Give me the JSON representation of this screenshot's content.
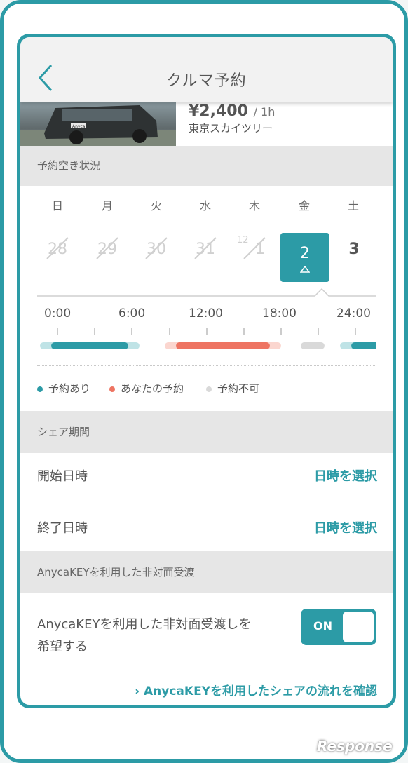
{
  "nav": {
    "title": "クルマ予約"
  },
  "car": {
    "price": "¥2,400",
    "unit": "/ 1h",
    "location": "東京スカイツリー",
    "badge": "Anyca"
  },
  "availability": {
    "section_title": "予約空き状況",
    "weekdays": [
      "日",
      "月",
      "火",
      "水",
      "木",
      "金",
      "土"
    ],
    "dates": [
      "28",
      "29",
      "30",
      "31",
      "1"
    ],
    "month_label": "12",
    "selected_date": "2",
    "next_date": "3",
    "time_labels": [
      "0:00",
      "6:00",
      "12:00",
      "18:00",
      "24:00"
    ]
  },
  "legend": {
    "reserved": "予約あり",
    "yours": "あなたの予約",
    "unavailable": "予約不可"
  },
  "share": {
    "section_title": "シェア期間",
    "start_label": "開始日時",
    "end_label": "終了日時",
    "select_label": "日時を選択"
  },
  "anycakey": {
    "section_title": "AnycaKEYを利用した非対面受渡",
    "option_line1": "AnycaKEYを利用した非対面受渡しを",
    "option_line2": "希望する",
    "toggle_label": "ON",
    "link_text": "AnycaKEYを利用したシェアの流れを確認"
  },
  "watermark": "Response",
  "colors": {
    "accent": "#2c9ba6",
    "your_reservation": "#ee7462",
    "unavailable": "#d9d9d9"
  }
}
